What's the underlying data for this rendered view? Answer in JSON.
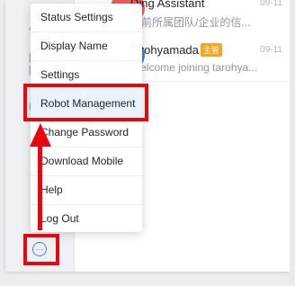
{
  "menu": {
    "items": [
      {
        "label": "Status Settings"
      },
      {
        "label": "Display Name"
      },
      {
        "label": "Settings"
      },
      {
        "label": "Robot Management"
      },
      {
        "label": "Change Password"
      },
      {
        "label": "Download Mobile"
      },
      {
        "label": "Help"
      },
      {
        "label": "Log Out"
      }
    ],
    "highlighted_item": "Robot Management"
  },
  "chats": [
    {
      "name": "Ding Assistant",
      "time": "09-11",
      "preview": "当前所属团队/企业的信..."
    },
    {
      "name": "tarohyamada",
      "badge": "主管",
      "time": "09-11",
      "preview": "Welcome joining tarohya..."
    }
  ],
  "left_rail": {
    "glyphs": [
      "4",
      "[",
      "[",
      "("
    ]
  },
  "more_button": {
    "icon": "ellipsis-circle-icon",
    "symbol": "···"
  },
  "annotation": {
    "color": "#e8060f"
  },
  "colors": {
    "accent": "#4a7fd4",
    "badge": "#f5a623",
    "avatar": "#f05d5d"
  }
}
